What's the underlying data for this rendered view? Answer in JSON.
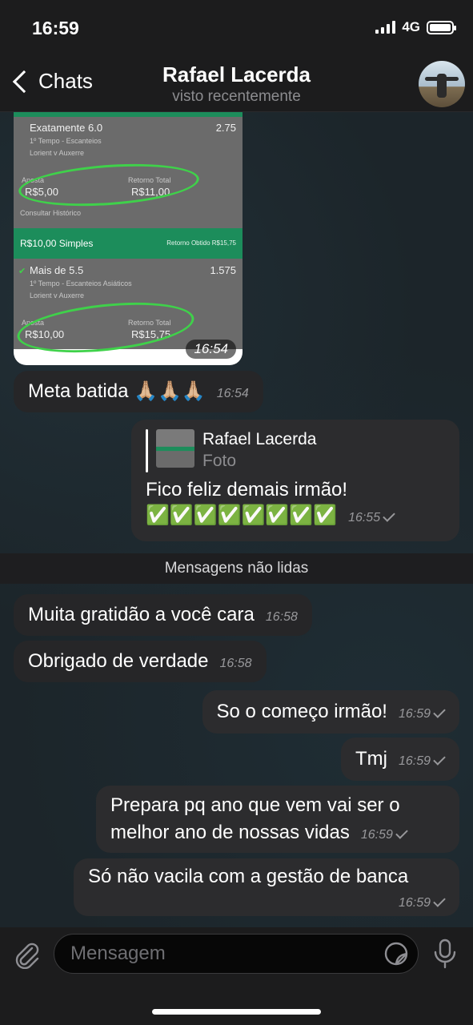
{
  "status_bar": {
    "time": "16:59",
    "network": "4G"
  },
  "header": {
    "back_label": "Chats",
    "contact_name": "Rafael Lacerda",
    "contact_status": "visto recentemente"
  },
  "image_message": {
    "time": "16:54",
    "slip": {
      "bet1_market": "Exatamente 6.0",
      "bet1_odds": "2.75",
      "bet1_period": "1º Tempo - Escanteios",
      "bet1_match": "Lorient v Auxerre",
      "bet1_stake_label": "Aposta",
      "bet1_stake": "R$5,00",
      "bet1_return_label": "Retorno Total",
      "bet1_return": "R$11,00",
      "history_link": "Consultar Histórico",
      "bet2_header": "R$10,00 Simples",
      "bet2_header_right": "Retorno Obtido R$15,75",
      "bet2_market": "Mais de 5.5",
      "bet2_odds": "1.575",
      "bet2_period": "1º Tempo - Escanteios Asiáticos",
      "bet2_match": "Lorient v Auxerre",
      "bet2_stake_label": "Aposta",
      "bet2_stake": "R$10,00",
      "bet2_return_label": "Retorno Total",
      "bet2_return": "R$15,75"
    }
  },
  "messages": [
    {
      "text": "Meta batida 🙏🏼🙏🏼🙏🏼",
      "time": "16:54"
    },
    {
      "reply_name": "Rafael Lacerda",
      "reply_type": "Foto",
      "text": "Fico feliz demais irmão!",
      "emoji_line": "✅✅✅✅✅✅✅✅",
      "time": "16:55"
    },
    {
      "text": "Muita gratidão a você cara",
      "time": "16:58"
    },
    {
      "text": "Obrigado de verdade",
      "time": "16:58"
    },
    {
      "text": "So o começo irmão!",
      "time": "16:59"
    },
    {
      "text": "Tmj",
      "time": "16:59"
    },
    {
      "text_line1": "Prepara pq ano que vem vai ser o",
      "text_line2": "melhor ano de nossas vidas",
      "time": "16:59"
    },
    {
      "text": "Só não vacila com a gestão de banca",
      "time": "16:59"
    }
  ],
  "unread_divider": "Mensagens não lidas",
  "composer": {
    "placeholder": "Mensagem"
  },
  "icons": {
    "back": "chevron-left-icon",
    "attach": "paperclip-icon",
    "sticker": "sticker-icon",
    "mic": "microphone-icon",
    "read": "double-check-icon",
    "sent": "check-icon"
  },
  "colors": {
    "accent_green": "#1c8d5b",
    "circle_green": "#3fd14a",
    "bubble_out": "#2c2c2e",
    "bubble_in": "#262628"
  }
}
